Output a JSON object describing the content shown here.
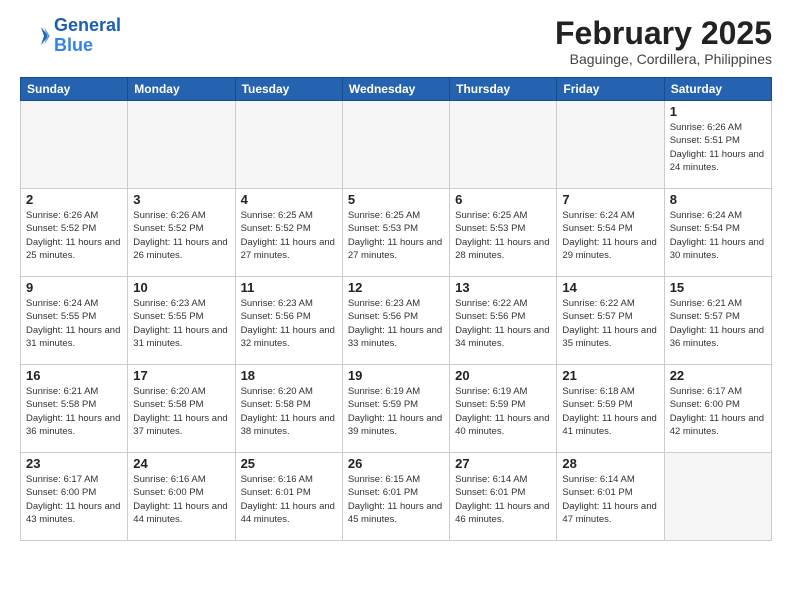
{
  "logo": {
    "line1": "General",
    "line2": "Blue"
  },
  "title": "February 2025",
  "subtitle": "Baguinge, Cordillera, Philippines",
  "days_of_week": [
    "Sunday",
    "Monday",
    "Tuesday",
    "Wednesday",
    "Thursday",
    "Friday",
    "Saturday"
  ],
  "weeks": [
    {
      "alt": false,
      "days": [
        {
          "num": "",
          "empty": true
        },
        {
          "num": "",
          "empty": true
        },
        {
          "num": "",
          "empty": true
        },
        {
          "num": "",
          "empty": true
        },
        {
          "num": "",
          "empty": true
        },
        {
          "num": "",
          "empty": true
        },
        {
          "num": "1",
          "sunrise": "6:26 AM",
          "sunset": "5:51 PM",
          "daylight": "11 hours and 24 minutes."
        }
      ]
    },
    {
      "alt": false,
      "days": [
        {
          "num": "2",
          "sunrise": "6:26 AM",
          "sunset": "5:52 PM",
          "daylight": "11 hours and 25 minutes."
        },
        {
          "num": "3",
          "sunrise": "6:26 AM",
          "sunset": "5:52 PM",
          "daylight": "11 hours and 26 minutes."
        },
        {
          "num": "4",
          "sunrise": "6:25 AM",
          "sunset": "5:52 PM",
          "daylight": "11 hours and 27 minutes."
        },
        {
          "num": "5",
          "sunrise": "6:25 AM",
          "sunset": "5:53 PM",
          "daylight": "11 hours and 27 minutes."
        },
        {
          "num": "6",
          "sunrise": "6:25 AM",
          "sunset": "5:53 PM",
          "daylight": "11 hours and 28 minutes."
        },
        {
          "num": "7",
          "sunrise": "6:24 AM",
          "sunset": "5:54 PM",
          "daylight": "11 hours and 29 minutes."
        },
        {
          "num": "8",
          "sunrise": "6:24 AM",
          "sunset": "5:54 PM",
          "daylight": "11 hours and 30 minutes."
        }
      ]
    },
    {
      "alt": true,
      "days": [
        {
          "num": "9",
          "sunrise": "6:24 AM",
          "sunset": "5:55 PM",
          "daylight": "11 hours and 31 minutes."
        },
        {
          "num": "10",
          "sunrise": "6:23 AM",
          "sunset": "5:55 PM",
          "daylight": "11 hours and 31 minutes."
        },
        {
          "num": "11",
          "sunrise": "6:23 AM",
          "sunset": "5:56 PM",
          "daylight": "11 hours and 32 minutes."
        },
        {
          "num": "12",
          "sunrise": "6:23 AM",
          "sunset": "5:56 PM",
          "daylight": "11 hours and 33 minutes."
        },
        {
          "num": "13",
          "sunrise": "6:22 AM",
          "sunset": "5:56 PM",
          "daylight": "11 hours and 34 minutes."
        },
        {
          "num": "14",
          "sunrise": "6:22 AM",
          "sunset": "5:57 PM",
          "daylight": "11 hours and 35 minutes."
        },
        {
          "num": "15",
          "sunrise": "6:21 AM",
          "sunset": "5:57 PM",
          "daylight": "11 hours and 36 minutes."
        }
      ]
    },
    {
      "alt": false,
      "days": [
        {
          "num": "16",
          "sunrise": "6:21 AM",
          "sunset": "5:58 PM",
          "daylight": "11 hours and 36 minutes."
        },
        {
          "num": "17",
          "sunrise": "6:20 AM",
          "sunset": "5:58 PM",
          "daylight": "11 hours and 37 minutes."
        },
        {
          "num": "18",
          "sunrise": "6:20 AM",
          "sunset": "5:58 PM",
          "daylight": "11 hours and 38 minutes."
        },
        {
          "num": "19",
          "sunrise": "6:19 AM",
          "sunset": "5:59 PM",
          "daylight": "11 hours and 39 minutes."
        },
        {
          "num": "20",
          "sunrise": "6:19 AM",
          "sunset": "5:59 PM",
          "daylight": "11 hours and 40 minutes."
        },
        {
          "num": "21",
          "sunrise": "6:18 AM",
          "sunset": "5:59 PM",
          "daylight": "11 hours and 41 minutes."
        },
        {
          "num": "22",
          "sunrise": "6:17 AM",
          "sunset": "6:00 PM",
          "daylight": "11 hours and 42 minutes."
        }
      ]
    },
    {
      "alt": true,
      "days": [
        {
          "num": "23",
          "sunrise": "6:17 AM",
          "sunset": "6:00 PM",
          "daylight": "11 hours and 43 minutes."
        },
        {
          "num": "24",
          "sunrise": "6:16 AM",
          "sunset": "6:00 PM",
          "daylight": "11 hours and 44 minutes."
        },
        {
          "num": "25",
          "sunrise": "6:16 AM",
          "sunset": "6:01 PM",
          "daylight": "11 hours and 44 minutes."
        },
        {
          "num": "26",
          "sunrise": "6:15 AM",
          "sunset": "6:01 PM",
          "daylight": "11 hours and 45 minutes."
        },
        {
          "num": "27",
          "sunrise": "6:14 AM",
          "sunset": "6:01 PM",
          "daylight": "11 hours and 46 minutes."
        },
        {
          "num": "28",
          "sunrise": "6:14 AM",
          "sunset": "6:01 PM",
          "daylight": "11 hours and 47 minutes."
        },
        {
          "num": "",
          "empty": true
        }
      ]
    }
  ]
}
